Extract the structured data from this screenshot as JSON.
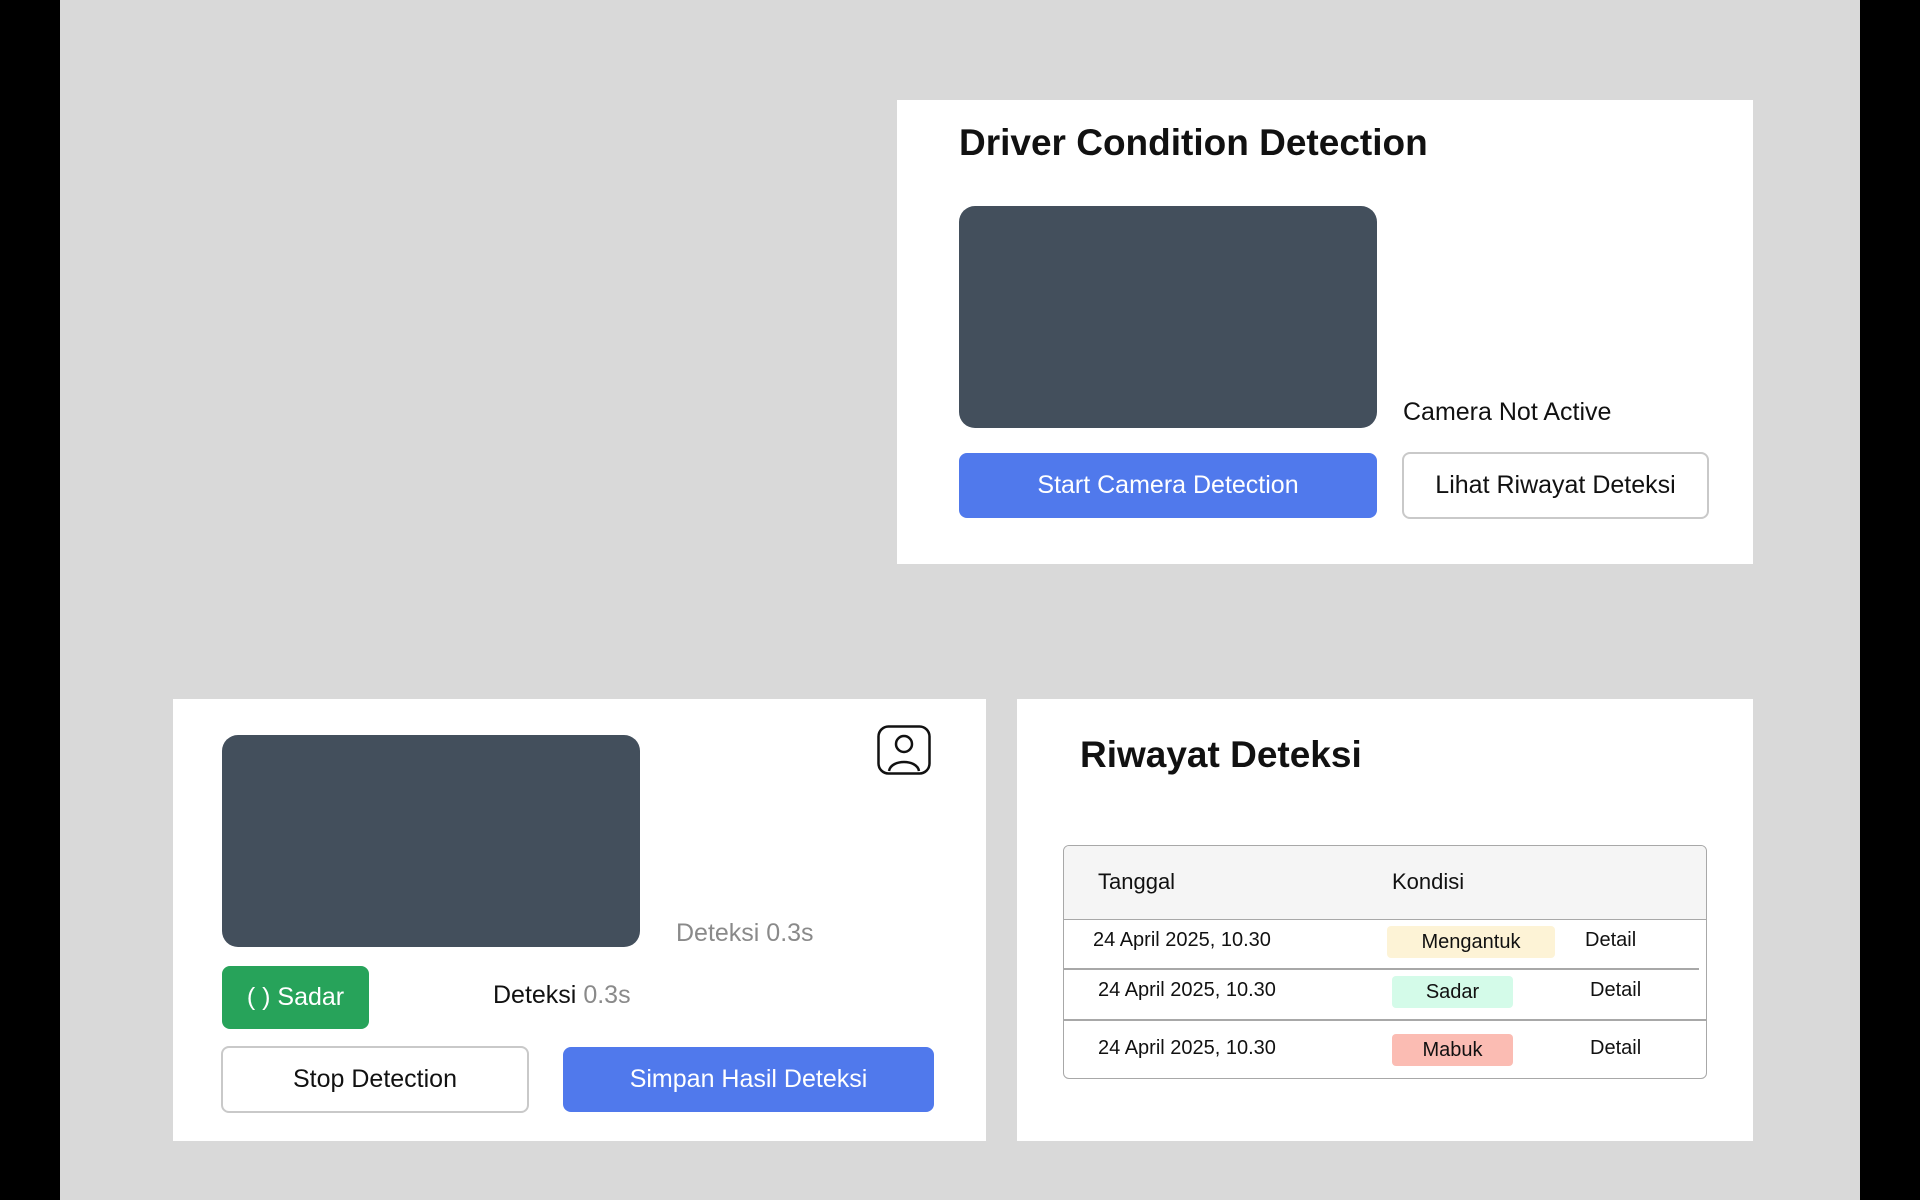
{
  "detection_panel": {
    "title": "Driver Condition Detection",
    "camera_status": "Camera Not Active",
    "start_button": "Start Camera Detection",
    "history_button": "Lihat Riwayat Deteksi"
  },
  "active_panel": {
    "detection_time_label": "Deteksi 0.3s",
    "status_badge": "( ) Sadar",
    "detection_label": "Deteksi",
    "detection_value": "0.3s",
    "stop_button": "Stop Detection",
    "save_button": "Simpan Hasil Deteksi",
    "user_icon": "user-profile-icon"
  },
  "history_panel": {
    "title": "Riwayat Deteksi",
    "columns": [
      "Tanggal",
      "Kondisi"
    ],
    "rows": [
      {
        "date": "24 April 2025, 10.30",
        "condition": "Mengantuk",
        "action": "Detail",
        "color": "#fdf3d6"
      },
      {
        "date": "24 April 2025, 10.30",
        "condition": "Sadar",
        "action": "Detail",
        "color": "#d4fbe9"
      },
      {
        "date": "24 April 2025, 10.30",
        "condition": "Mabuk",
        "action": "Detail",
        "color": "#fbbcb3"
      }
    ]
  },
  "colors": {
    "primary": "#5079ec",
    "success": "#27a35a",
    "camera": "#434f5c",
    "background": "#d9d9d9"
  }
}
